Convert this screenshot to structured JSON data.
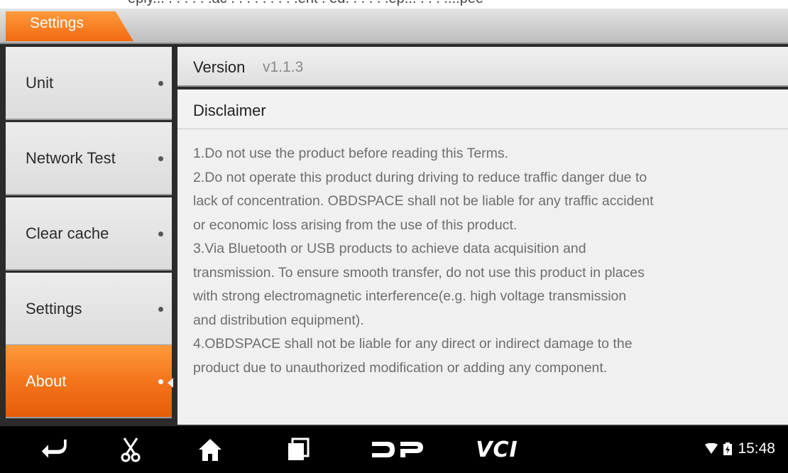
{
  "header": {
    "top_strip_text": "eply... . . . . . .ac . . . . . . . . .ent . ed. . . . . .ep... . . . ....pee",
    "title": "Settings"
  },
  "sidebar": {
    "items": [
      {
        "label": "Unit",
        "active": false
      },
      {
        "label": "Network Test",
        "active": false
      },
      {
        "label": "Clear cache",
        "active": false
      },
      {
        "label": "Settings",
        "active": false
      },
      {
        "label": "About",
        "active": true
      }
    ]
  },
  "main": {
    "version_label": "Version",
    "version_value": "v1.1.3",
    "disclaimer_title": "Disclaimer",
    "disclaimer_lines": [
      "1.Do not use the product before reading this Terms.",
      "2.Do not operate this product during driving to reduce traffic danger due to",
      "lack of concentration. OBDSPACE shall not be liable for any traffic accident",
      "or economic loss arising from the use of this product.",
      "3.Via Bluetooth or USB products to achieve data acquisition and",
      "transmission. To ensure smooth transfer, do not use this product in places",
      "with strong electromagnetic interference(e.g. high voltage transmission",
      "and distribution equipment).",
      "4.OBDSPACE shall not be liable for any direct or indirect damage to the",
      "product due to unauthorized modification or adding any component."
    ]
  },
  "navbar": {
    "icons": [
      "back-icon",
      "scissors-icon",
      "home-icon",
      "recent-apps-icon",
      "dp-logo-icon",
      "vci-icon"
    ],
    "vci_text": "VCI",
    "dp_text": "DP",
    "time": "15:48"
  },
  "colors": {
    "accent": "#f5781f",
    "accent_dark": "#e65c0a",
    "text_muted": "#6e6e6e"
  }
}
